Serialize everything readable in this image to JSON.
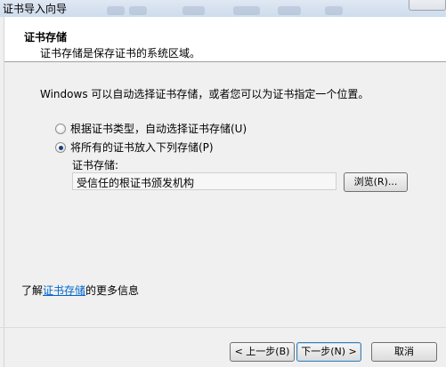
{
  "window": {
    "title": "证书导入向导"
  },
  "header": {
    "title": "证书存储",
    "description": "证书存储是保存证书的系统区域。"
  },
  "body": {
    "intro": "Windows 可以自动选择证书存储，或者您可以为证书指定一个位置。",
    "options": [
      {
        "label": "根据证书类型，自动选择证书存储(U)",
        "selected": false
      },
      {
        "label": "将所有的证书放入下列存储(P)",
        "selected": true
      }
    ],
    "store_label": "证书存储:",
    "store_value": "受信任的根证书颁发机构",
    "browse_label": "浏览(R)..."
  },
  "learn_more": {
    "prefix": "了解",
    "link": "证书存储",
    "suffix": "的更多信息"
  },
  "buttons": {
    "back": "< 上一步(B)",
    "next": "下一步(N) >",
    "cancel": "取消"
  }
}
